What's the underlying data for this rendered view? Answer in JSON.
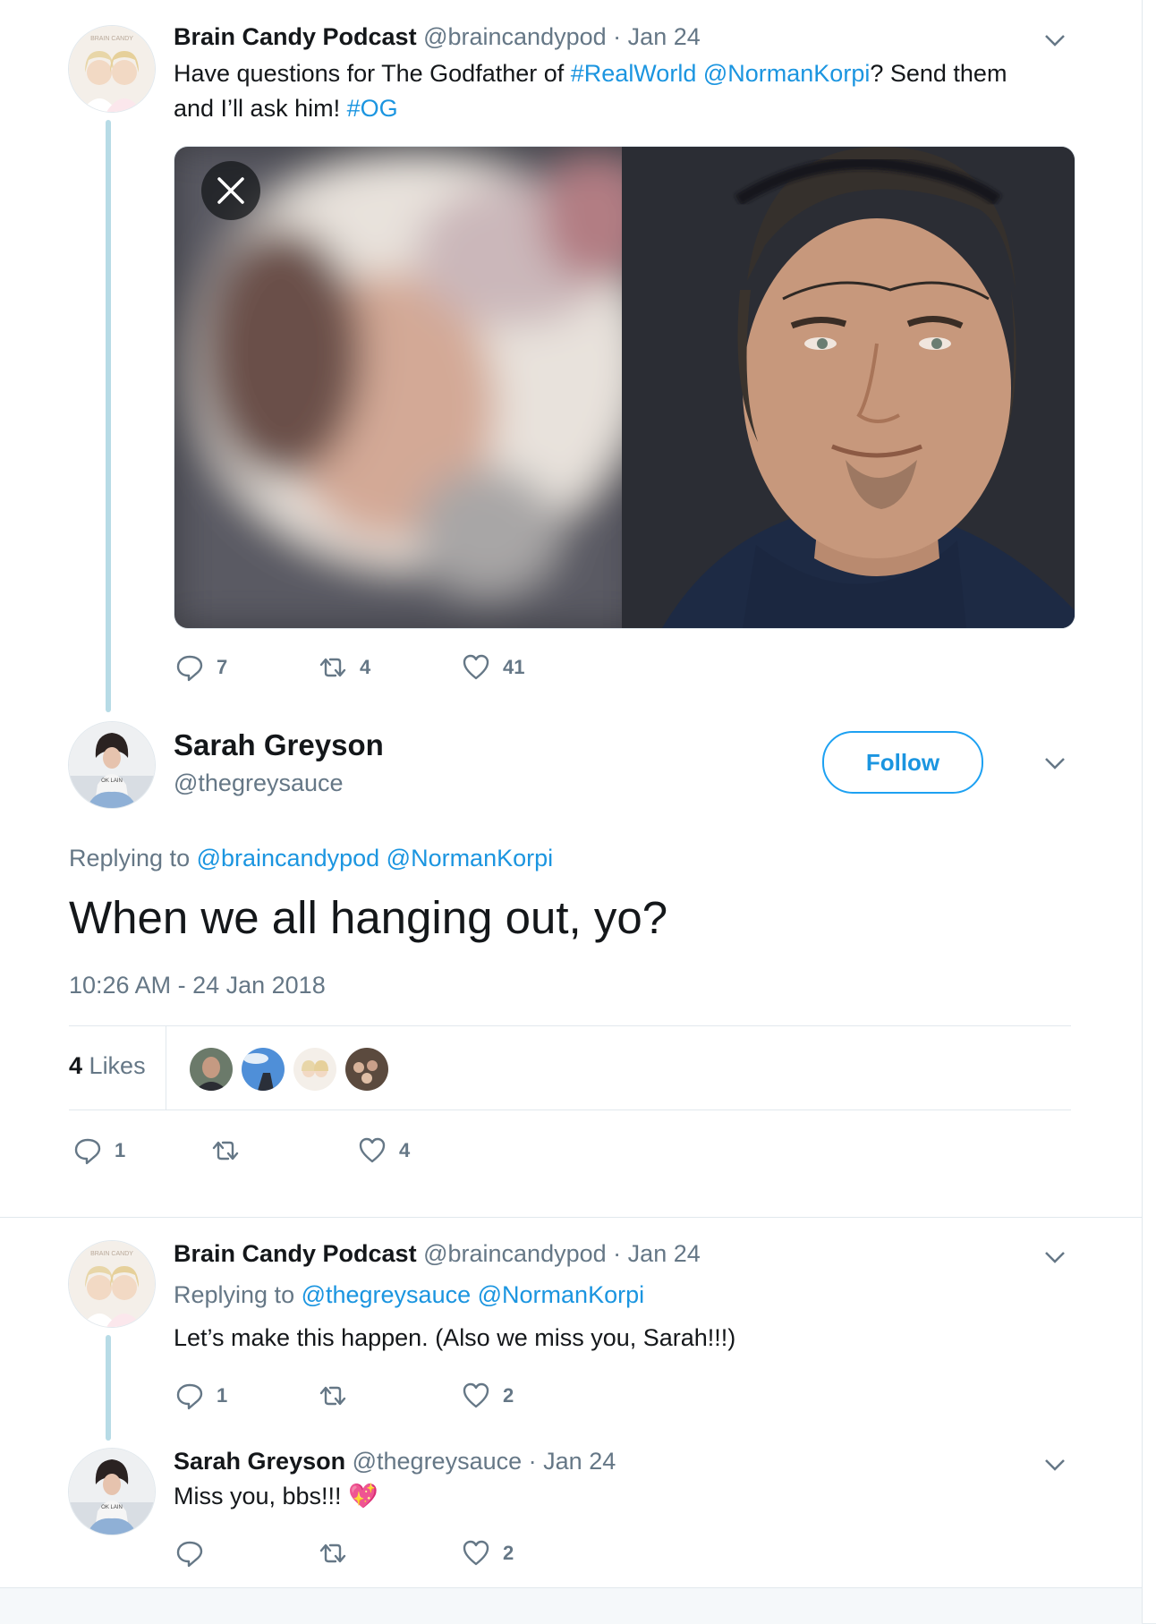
{
  "tweet1": {
    "name": "Brain Candy Podcast",
    "handle": "@braincandypod",
    "separator": "·",
    "date": "Jan 24",
    "text_a": "Have questions for The Godfather of ",
    "hashtag1": "#RealWorld",
    "mention1": "@NormanKorpi",
    "text_b": "? Send them",
    "text_c": "and I’ll ask him! ",
    "hashtag2": "#OG",
    "replies": "7",
    "retweets": "4",
    "likes": "41"
  },
  "main": {
    "name": "Sarah Greyson",
    "handle": "@thegreysauce",
    "follow_label": "Follow",
    "replying_to_label": "Replying to ",
    "reply_mention1": "@braincandypod",
    "reply_mention2": "@NormanKorpi",
    "text": "When we all hanging out, yo?",
    "timestamp": "10:26 AM - 24 Jan 2018",
    "likes_count": "4",
    "likes_label": "Likes",
    "replies": "1",
    "retweets": "",
    "likes": "4"
  },
  "tweet3": {
    "name": "Brain Candy Podcast",
    "handle": "@braincandypod",
    "separator": "·",
    "date": "Jan 24",
    "replying_to_label": "Replying to ",
    "reply_mention1": "@thegreysauce",
    "reply_mention2": "@NormanKorpi",
    "text": "Let’s make this happen. (Also we miss you, Sarah!!!)",
    "replies": "1",
    "retweets": "",
    "likes": "2"
  },
  "tweet4": {
    "name": "Sarah Greyson",
    "handle": "@thegreysauce",
    "separator": "·",
    "date": "Jan 24",
    "text": "Miss you, bbs!!! ",
    "emoji": "💖",
    "replies": "",
    "retweets": "",
    "likes": "2"
  },
  "colors": {
    "link": "#1b95e0",
    "muted": "#657786",
    "thread_line": "#b7dbe6"
  },
  "icons": [
    "reply-icon",
    "retweet-icon",
    "like-icon",
    "chevron-down-icon",
    "close-icon"
  ]
}
